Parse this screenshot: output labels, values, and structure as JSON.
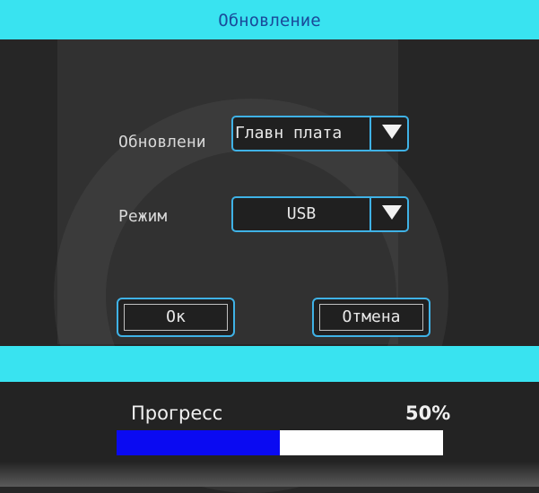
{
  "dialog": {
    "title": "Обновление",
    "update_label": "Обновлени",
    "update_value": "Главн плата",
    "mode_label": "Режим",
    "mode_value": "USB",
    "ok_label": "Ок",
    "cancel_label": "Отмена"
  },
  "progress": {
    "label": "Прогресс",
    "percent_text": "50%",
    "fraction": 0.5
  },
  "colors": {
    "header": "#39e3f0",
    "accent_border": "#3fb2e6",
    "progress_fill": "#0a0af2",
    "progress_track": "#ffffff"
  },
  "icons": {
    "dropdown": "triangle-down-icon"
  }
}
